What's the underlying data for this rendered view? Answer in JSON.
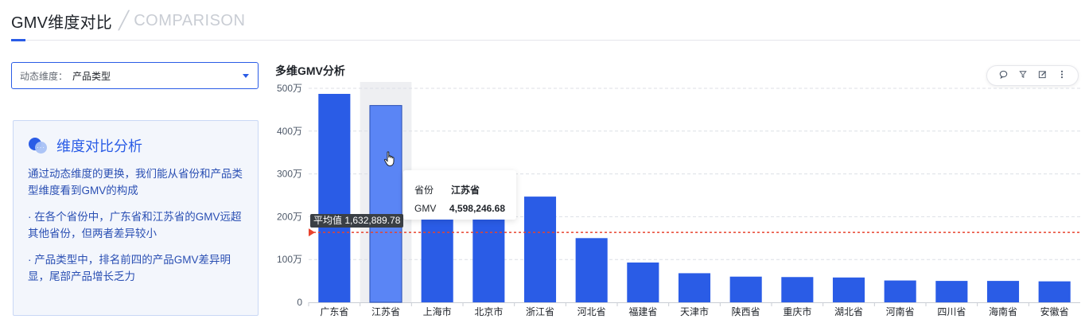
{
  "header": {
    "title": "GMV维度对比",
    "subtitle": "COMPARISON"
  },
  "select": {
    "label": "动态维度：",
    "value": "产品类型"
  },
  "card": {
    "title": "维度对比分析",
    "p1": "通过动态维度的更换，我们能从省份和产品类型维度看到GMV的构成",
    "p2": "· 在各个省份中，广东省和江苏省的GMV远超其他省份，但两者差异较小",
    "p3": "· 产品类型中，排名前四的产品GMV差异明显，尾部产品增长乏力"
  },
  "toolbar": {
    "icons": [
      "comment-icon",
      "filter-icon",
      "edit-icon",
      "more-icon"
    ]
  },
  "tooltip": {
    "k1": "省份",
    "v1": "江苏省",
    "k2": "GMV",
    "v2": "4,598,246.68"
  },
  "avg": {
    "label": "平均值 1,632,889.78"
  },
  "colors": {
    "bar": "#2a5ce6",
    "bar_hover": "#5a85f5",
    "avg_line": "#e8432e"
  },
  "chart_data": {
    "type": "bar",
    "title": "多维GMV分析",
    "categories": [
      "广东省",
      "江苏省",
      "上海市",
      "北京市",
      "浙江省",
      "河北省",
      "福建省",
      "天津市",
      "陕西省",
      "重庆市",
      "湖北省",
      "河南省",
      "四川省",
      "海南省",
      "安徽省"
    ],
    "values": [
      4870000,
      4598246.68,
      2500000,
      2480000,
      2470000,
      1500000,
      930000,
      680000,
      600000,
      590000,
      580000,
      510000,
      500000,
      500000,
      490000
    ],
    "yticks": [
      0,
      1000000,
      2000000,
      3000000,
      4000000,
      5000000
    ],
    "ytick_labels": [
      "0",
      "100万",
      "200万",
      "300万",
      "400万",
      "500万"
    ],
    "ylim": [
      0,
      5000000
    ],
    "average": 1632889.78,
    "highlighted_index": 1,
    "grid": true
  }
}
